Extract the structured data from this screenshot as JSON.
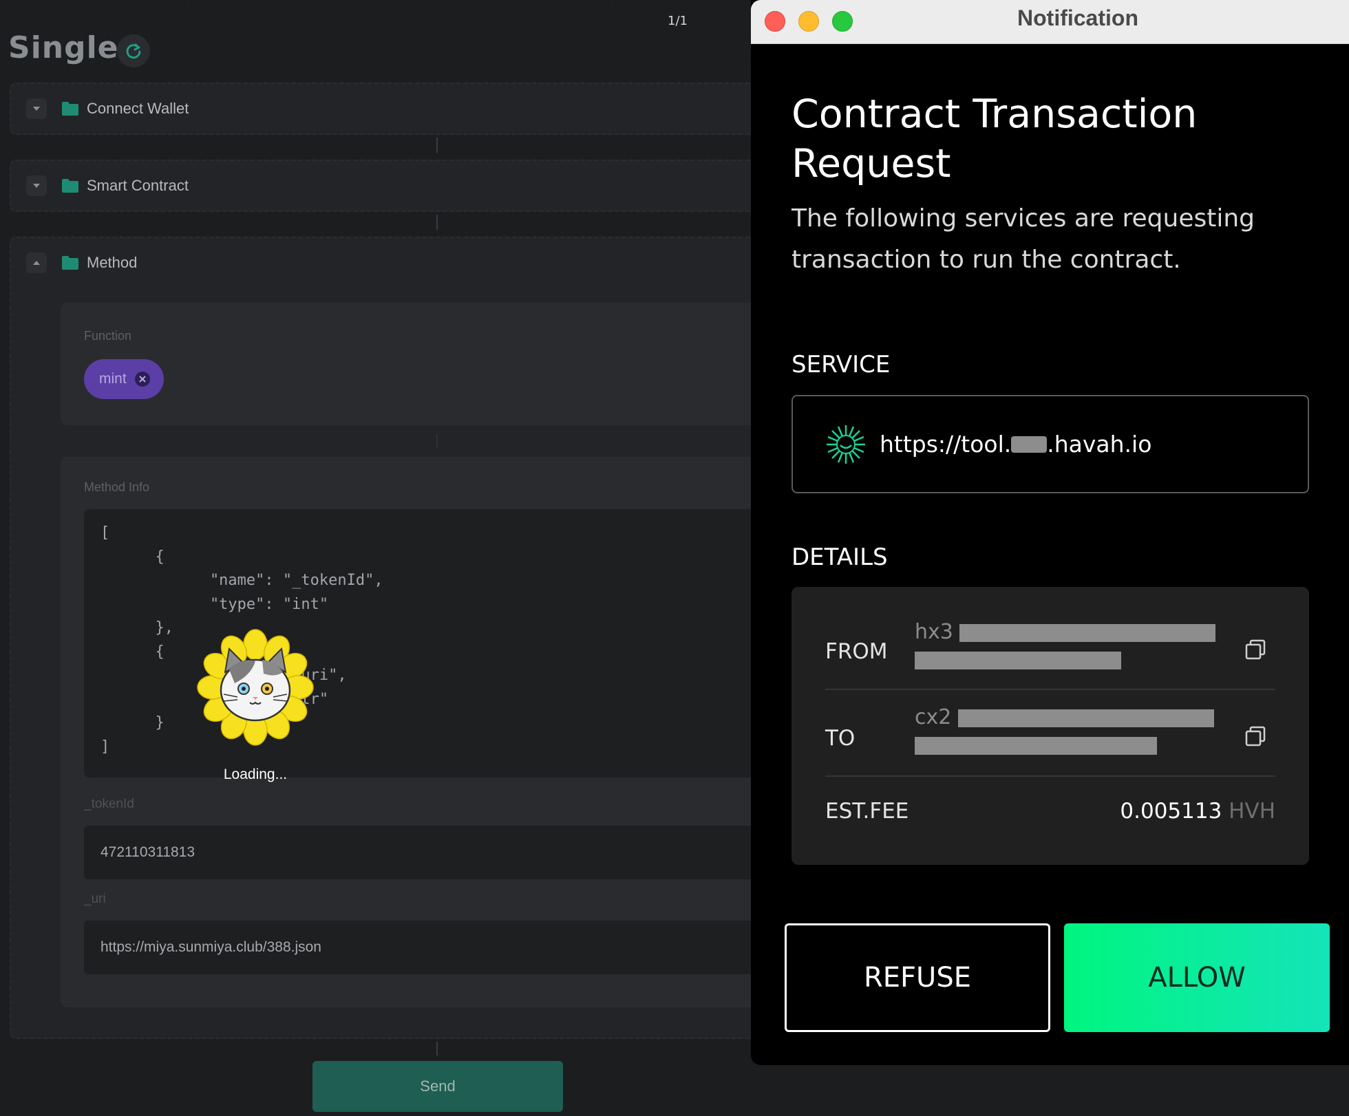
{
  "app": {
    "page_counter": "1/1",
    "title": "Single",
    "sections": {
      "connect_wallet": "Connect Wallet",
      "smart_contract": "Smart Contract",
      "method": "Method"
    },
    "function_label": "Function",
    "function_chip": "mint",
    "method_info_label": "Method Info",
    "method_info_code": "[\n      {\n            \"name\": \"_tokenId\",\n            \"type\": \"int\"\n      },\n      {\n            \"name\": \"_uri\",\n            \"type\": \"str\"\n      }\n]",
    "token_id_label": "_tokenId",
    "token_id_value": "472110311813",
    "uri_label": "_uri",
    "uri_value": "https://miya.sunmiya.club/388.json",
    "loading_text": "Loading...",
    "send_label": "Send"
  },
  "notification": {
    "window_title": "Notification",
    "title": "Contract Transaction Request",
    "subtitle": "The following services are requesting transaction to run the contract.",
    "service_heading": "SERVICE",
    "service_url_prefix": "https://tool.",
    "service_url_suffix": ".havah.io",
    "details_heading": "DETAILS",
    "from_label": "FROM",
    "from_prefix": "hx3",
    "to_label": "TO",
    "to_prefix": "cx2",
    "fee_label": "EST.FEE",
    "fee_value": "0.005113",
    "fee_unit": "HVH",
    "refuse_label": "REFUSE",
    "allow_label": "ALLOW"
  },
  "colors": {
    "accent_green": "#00f57f",
    "chip_purple": "#5b3fa6",
    "send_teal": "#1f5e52"
  },
  "icons": {
    "refresh": "refresh-icon",
    "folder": "folder-icon",
    "caret": "caret-icon",
    "copy": "copy-icon",
    "service_logo": "havah-logo-icon",
    "loader": "cat-flower-loader"
  }
}
